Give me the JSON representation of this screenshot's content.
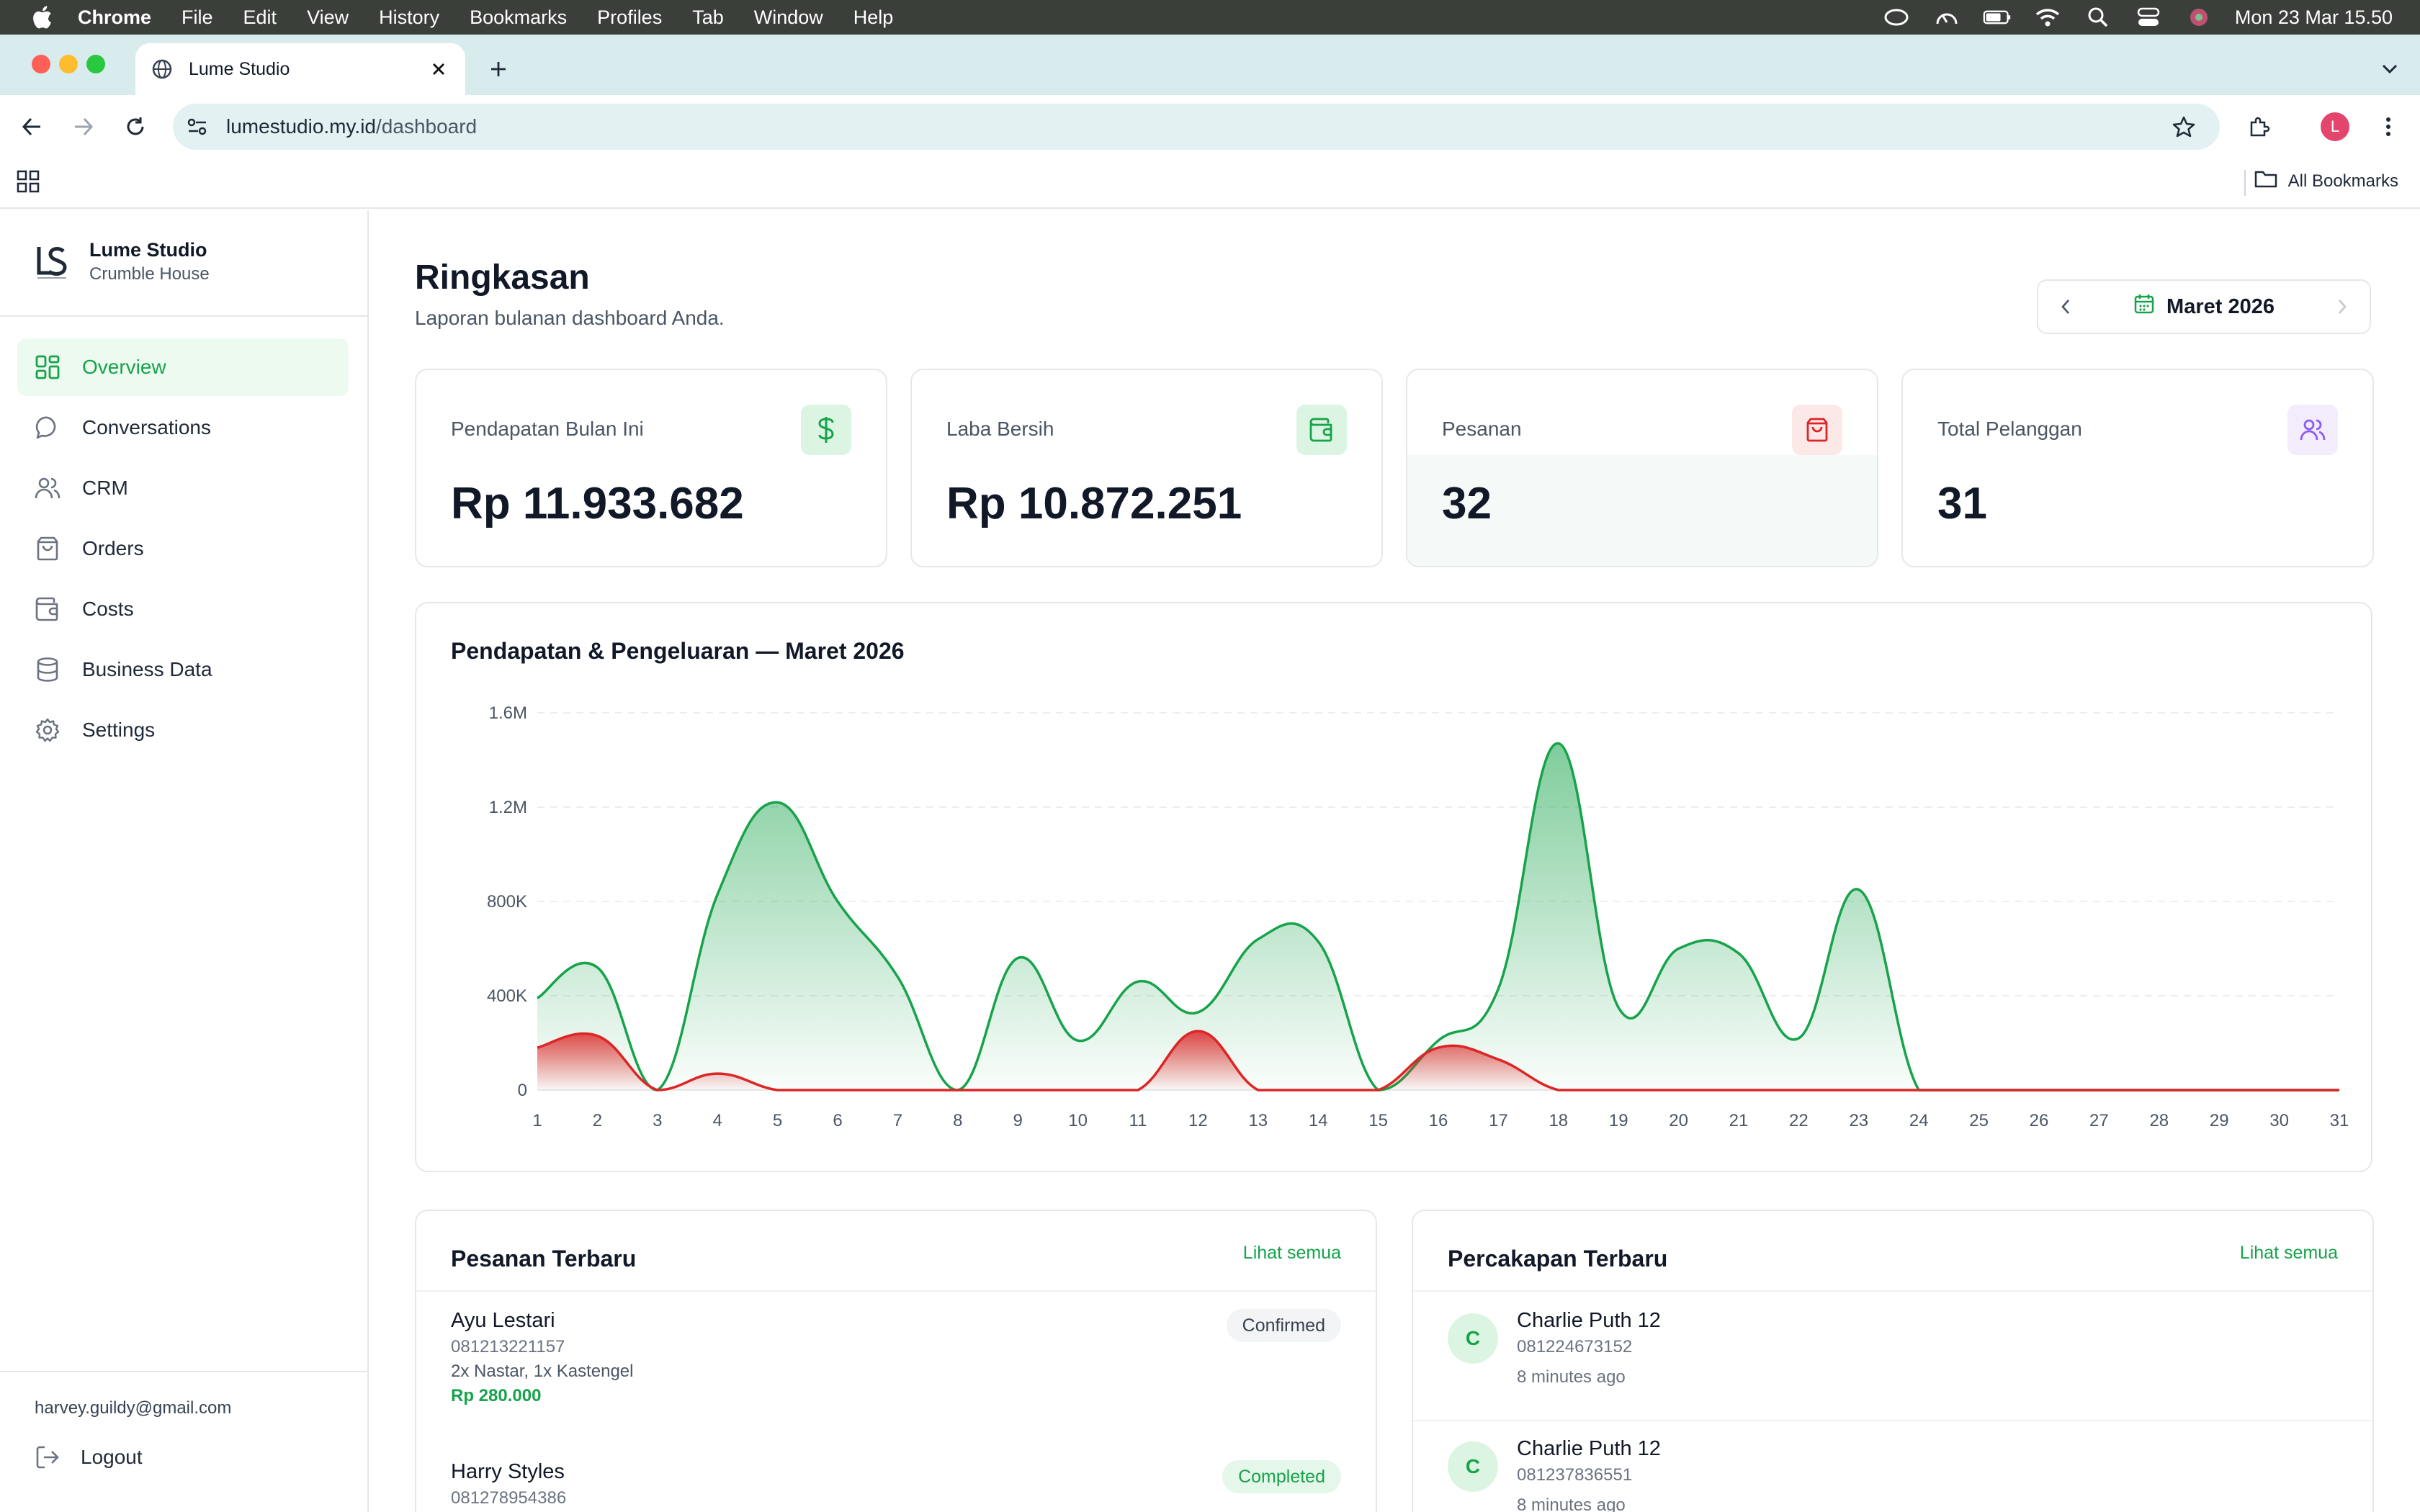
{
  "menubar": {
    "app": "Chrome",
    "items": [
      "File",
      "Edit",
      "View",
      "History",
      "Bookmarks",
      "Profiles",
      "Tab",
      "Window",
      "Help"
    ],
    "clock": "Mon 23 Mar  15.50"
  },
  "browser": {
    "tab_title": "Lume Studio",
    "url_host": "lumestudio.my.id",
    "url_path": "/dashboard",
    "profile_initial": "L",
    "all_bookmarks": "All Bookmarks"
  },
  "sidebar": {
    "brand_name": "Lume Studio",
    "brand_sub": "Crumble House",
    "items": [
      {
        "label": "Overview",
        "icon": "layout-grid-icon"
      },
      {
        "label": "Conversations",
        "icon": "chat-bubble-icon"
      },
      {
        "label": "CRM",
        "icon": "users-icon"
      },
      {
        "label": "Orders",
        "icon": "shopping-bag-icon"
      },
      {
        "label": "Costs",
        "icon": "wallet-icon"
      },
      {
        "label": "Business Data",
        "icon": "database-icon"
      },
      {
        "label": "Settings",
        "icon": "gear-icon"
      }
    ],
    "user_email": "harvey.guildy@gmail.com",
    "logout_label": "Logout"
  },
  "header": {
    "title": "Ringkasan",
    "subtitle": "Laporan bulanan dashboard Anda.",
    "month": "Maret 2026"
  },
  "stats": [
    {
      "label": "Pendapatan Bulan Ini",
      "value": "Rp 11.933.682",
      "icon": "dollar-icon"
    },
    {
      "label": "Laba Bersih",
      "value": "Rp 10.872.251",
      "icon": "wallet-icon"
    },
    {
      "label": "Pesanan",
      "value": "32",
      "icon": "shopping-bag-icon"
    },
    {
      "label": "Total Pelanggan",
      "value": "31",
      "icon": "users-icon"
    }
  ],
  "colors": {
    "accent": "#16a34a",
    "income": "#16a34a",
    "expense": "#dc2626"
  },
  "chart_title": "Pendapatan & Pengeluaran — Maret 2026",
  "chart_data": {
    "type": "area",
    "x": [
      1,
      2,
      3,
      4,
      5,
      6,
      7,
      8,
      9,
      10,
      11,
      12,
      13,
      14,
      15,
      16,
      17,
      18,
      19,
      20,
      21,
      22,
      23,
      24,
      25,
      26,
      27,
      28,
      29,
      30,
      31
    ],
    "yticks": [
      "0",
      "400K",
      "800K",
      "1.2M",
      "1.6M"
    ],
    "ylim": [
      0,
      1600000
    ],
    "grid": true,
    "series": [
      {
        "values": [
          390000,
          520000,
          0,
          830000,
          1220000,
          800000,
          480000,
          0,
          560000,
          210000,
          460000,
          330000,
          640000,
          630000,
          0,
          210000,
          430000,
          1470000,
          350000,
          600000,
          580000,
          220000,
          850000,
          0,
          0,
          0,
          0,
          0,
          0,
          0,
          0
        ]
      },
      {
        "values": [
          180000,
          230000,
          0,
          70000,
          0,
          0,
          0,
          0,
          0,
          0,
          0,
          250000,
          0,
          0,
          0,
          180000,
          130000,
          0,
          0,
          0,
          0,
          0,
          0,
          0,
          0,
          0,
          0,
          0,
          0,
          0,
          0
        ]
      }
    ]
  },
  "orders": {
    "title": "Pesanan Terbaru",
    "see_all": "Lihat semua",
    "items": [
      {
        "name": "Ayu Lestari",
        "phone": "081213221157",
        "items": "2x Nastar, 1x Kastengel",
        "amount": "Rp 280.000",
        "status": "Confirmed"
      },
      {
        "name": "Harry Styles",
        "phone": "081278954386",
        "status": "Completed"
      }
    ]
  },
  "conversations": {
    "title": "Percakapan Terbaru",
    "see_all": "Lihat semua",
    "items": [
      {
        "initial": "C",
        "name": "Charlie Puth 12",
        "phone": "081224673152",
        "time": "8 minutes ago"
      },
      {
        "initial": "C",
        "name": "Charlie Puth 12",
        "phone": "081237836551",
        "time": "8 minutes ago"
      }
    ]
  }
}
